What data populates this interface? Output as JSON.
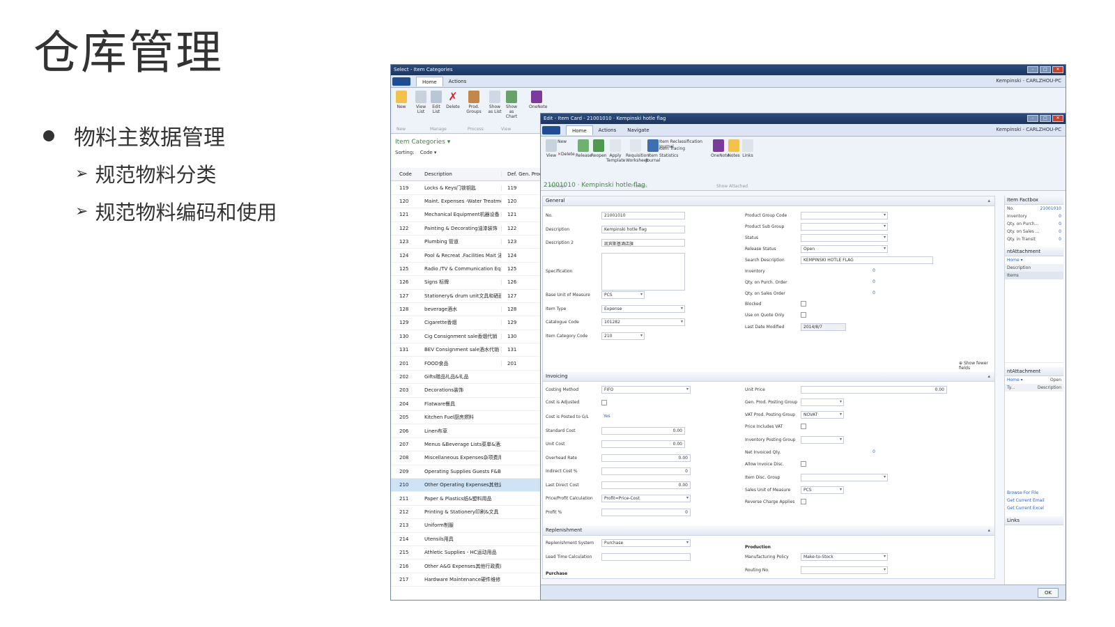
{
  "slide": {
    "title": "仓库管理",
    "bullet": "物料主数据管理",
    "sub1": "规范物料分类",
    "sub2": "规范物料编码和使用"
  },
  "back_window": {
    "title": "Select - Item Categories",
    "tabs": [
      "Home",
      "Actions"
    ],
    "user": "Kempinski - CARLZHOU-PC",
    "ribbon_buttons": [
      "New",
      "View List",
      "Edit List",
      "Delete",
      "Prod. Groups",
      "Show as List",
      "Show as Chart",
      "OneNote"
    ],
    "ribbon_groups": [
      "New",
      "Manage",
      "Process",
      "View"
    ],
    "list_title": "Item Categories ▾",
    "sorting_label": "Sorting:",
    "sorting_value": "Code ▾",
    "columns": [
      "Code",
      "Description",
      "Def. Gen. Prod."
    ],
    "rows": [
      [
        "119",
        "Locks & Keys门锁钥匙",
        "119"
      ],
      [
        "120",
        "Maint. Expenses -Water Treatme...",
        "120"
      ],
      [
        "121",
        "Mechanical Equipment机器设备",
        "121"
      ],
      [
        "122",
        "Painting & Decorating油漆装饰",
        "122"
      ],
      [
        "123",
        "Plumbing 管道",
        "123"
      ],
      [
        "124",
        "Pool & Recreat .Facilities Mait 泳...",
        "124"
      ],
      [
        "125",
        "Radio /TV & Communication Equ...",
        "125"
      ],
      [
        "126",
        "Signs 标牌",
        "126"
      ],
      [
        "127",
        "Stationery& drum unit文具和硒鼓",
        "127"
      ],
      [
        "128",
        "beverage酒水",
        "128"
      ],
      [
        "129",
        "Cigarette香烟",
        "129"
      ],
      [
        "130",
        "Cig Consignment sale香烟代销",
        "130"
      ],
      [
        "131",
        "BEV Consignment sale酒水代销",
        "131"
      ],
      [
        "201",
        "FOOD食品",
        "201"
      ],
      [
        "202",
        "Gifts赠品礼品&礼品",
        ""
      ],
      [
        "203",
        "Decorations装饰",
        ""
      ],
      [
        "204",
        "Flatware餐具",
        ""
      ],
      [
        "205",
        "Kitchen Fuel厨房燃料",
        ""
      ],
      [
        "206",
        "Linen布草",
        ""
      ],
      [
        "207",
        "Menus &Beverage Lists菜单&酒水单",
        ""
      ],
      [
        "208",
        "Miscellaneous Expenses杂项费用",
        ""
      ],
      [
        "209",
        "Operating Supplies Guests F&B/O...",
        ""
      ],
      [
        "210",
        "Other Operating Expenses其他运...",
        ""
      ],
      [
        "211",
        "Paper & Plastics纸&塑料用品",
        ""
      ],
      [
        "212",
        "Printing & Stationery印刷&文具",
        ""
      ],
      [
        "213",
        "Uniform制服",
        ""
      ],
      [
        "214",
        "Utensils用具",
        ""
      ],
      [
        "215",
        "Athletic Supplies - HC运动用品",
        ""
      ],
      [
        "216",
        "Other A&G Expenses其他行政费用",
        ""
      ],
      [
        "217",
        "Hardware Maintenance硬件维修",
        ""
      ]
    ],
    "selected_code": "210"
  },
  "front_window": {
    "title": "Edit - Item Card - 21001010 · Kempinski hotle flag",
    "tabs": [
      "Home",
      "Actions",
      "Navigate"
    ],
    "user": "Kempinski - CARLZHOU-PC",
    "ribbon_buttons": [
      "View",
      "New",
      "Delete",
      "Release",
      "Reopen",
      "Apply Template",
      "Requisition Worksheet",
      "Item Journal",
      "Item Reclassification Journal",
      "Item Tracing",
      "Statistics",
      "OneNote",
      "Notes",
      "Links"
    ],
    "ribbon_groups": [
      "Manage",
      "Process",
      "Show Attached"
    ],
    "doc_title": "21001010 · Kempinski hotle flag",
    "general_tab": "General",
    "general_left": [
      {
        "label": "No.",
        "value": "21001010"
      },
      {
        "label": "Description",
        "value": "Kempinski hotle flag"
      },
      {
        "label": "Description 2",
        "value": "凯宾斯基酒店旗"
      },
      {
        "label": "Specification",
        "value": ""
      },
      {
        "label": "Base Unit of Measure",
        "value": "PCS"
      },
      {
        "label": "Item Type",
        "value": "Expense"
      },
      {
        "label": "Catalogue Code",
        "value": "101282"
      },
      {
        "label": "Item Category Code",
        "value": "210"
      }
    ],
    "general_right": [
      {
        "label": "Product Group Code",
        "value": ""
      },
      {
        "label": "Product Sub Group",
        "value": ""
      },
      {
        "label": "Status",
        "value": ""
      },
      {
        "label": "Release Status",
        "value": "Open"
      },
      {
        "label": "Search Description",
        "value": "KEMPINSKI HOTLE FLAG"
      },
      {
        "label": "Inventory",
        "value": "0"
      },
      {
        "label": "Qty. on Purch. Order",
        "value": "0"
      },
      {
        "label": "Qty. on Sales Order",
        "value": "0"
      },
      {
        "label": "Blocked",
        "value": ""
      },
      {
        "label": "Use on Quote Only",
        "value": ""
      },
      {
        "label": "Last Date Modified",
        "value": "2014/8/7"
      }
    ],
    "show_fewer": "Show fewer fields",
    "invoicing_tab": "Invoicing",
    "invoicing_left": [
      {
        "label": "Costing Method",
        "value": "FIFO"
      },
      {
        "label": "Cost is Adjusted",
        "value": ""
      },
      {
        "label": "Cost is Posted to G/L",
        "value": "Yes"
      },
      {
        "label": "Standard Cost",
        "value": "0.00"
      },
      {
        "label": "Unit Cost",
        "value": "0.00"
      },
      {
        "label": "Overhead Rate",
        "value": "0.00"
      },
      {
        "label": "Indirect Cost %",
        "value": "0"
      },
      {
        "label": "Last Direct Cost",
        "value": "0.00"
      },
      {
        "label": "Price/Profit Calculation",
        "value": "Profit=Price-Cost"
      },
      {
        "label": "Profit %",
        "value": "0"
      }
    ],
    "invoicing_right": [
      {
        "label": "Unit Price",
        "value": "0.00"
      },
      {
        "label": "Gen. Prod. Posting Group",
        "value": ""
      },
      {
        "label": "VAT Prod. Posting Group",
        "value": "NOVAT"
      },
      {
        "label": "Price Includes VAT",
        "value": ""
      },
      {
        "label": "Inventory Posting Group",
        "value": ""
      },
      {
        "label": "Net Invoiced Qty.",
        "value": "0"
      },
      {
        "label": "Allow Invoice Disc.",
        "value": ""
      },
      {
        "label": "Item Disc. Group",
        "value": ""
      },
      {
        "label": "Sales Unit of Measure",
        "value": "PCS"
      },
      {
        "label": "Reverse Charge Applies",
        "value": ""
      }
    ],
    "replenishment_tab": "Replenishment",
    "replenishment_left": [
      {
        "label": "Replenishment System",
        "value": "Purchase"
      },
      {
        "label": "Lead Time Calculation",
        "value": ""
      }
    ],
    "purchase_label": "Purchase",
    "production_label": "Production",
    "replenishment_right": [
      {
        "label": "Manufacturing Policy",
        "value": "Make-to-Stock"
      },
      {
        "label": "Routing No.",
        "value": ""
      }
    ],
    "factbox": {
      "title": "Item Factbox",
      "rows": [
        {
          "label": "No.",
          "value": "21001010"
        },
        {
          "label": "Inventory",
          "value": "0"
        },
        {
          "label": "Qty. on Purch...",
          "value": "0"
        },
        {
          "label": "Qty. on Sales ...",
          "value": "0"
        },
        {
          "label": "Qty. in Transit",
          "value": "0"
        }
      ],
      "attach1": "ntAttachment",
      "attach2": "ntAttachment",
      "home_label": "Home ▾",
      "open_label": "Open",
      "description_col": "Description",
      "items_label": "Items",
      "type_col": "Ty...",
      "links": [
        "Browse For File",
        "Get Current Email",
        "Get Current Excel"
      ],
      "links_header": "Links"
    },
    "ok_button": "OK"
  }
}
